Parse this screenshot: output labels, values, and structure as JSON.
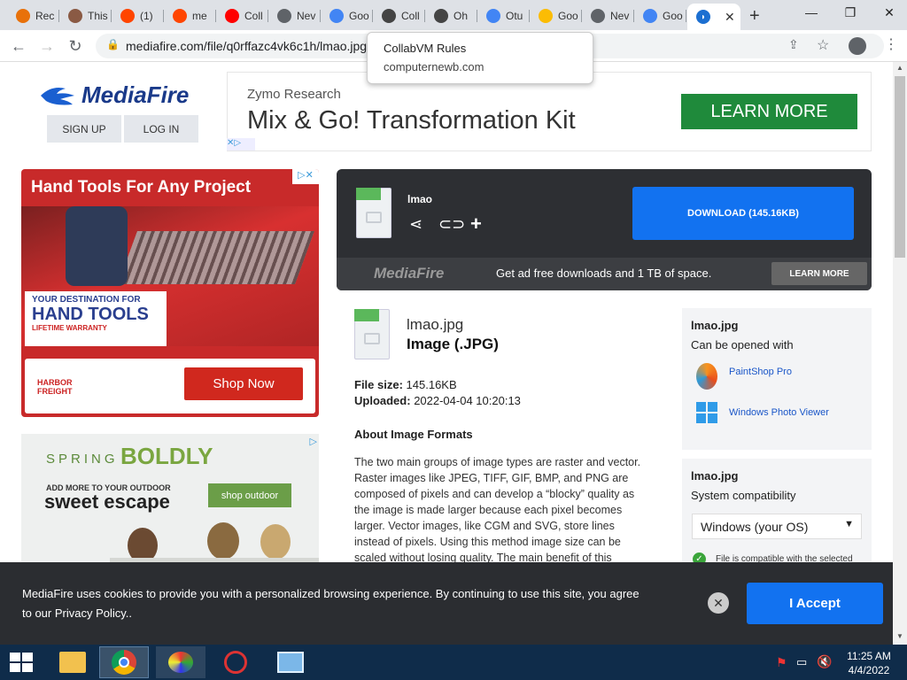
{
  "tabs": [
    {
      "title": "Rec",
      "icon": "pinwheel-icon",
      "color": "#e8710a"
    },
    {
      "title": "This",
      "icon": "avatar-icon",
      "color": "#8a5a44"
    },
    {
      "title": "(1) ",
      "icon": "reddit-icon",
      "color": "#ff4500"
    },
    {
      "title": "me",
      "icon": "reddit-icon",
      "color": "#ff4500"
    },
    {
      "title": "Coll",
      "icon": "youtube-icon",
      "color": "#ff0000"
    },
    {
      "title": "Nev",
      "icon": "chrome-page-icon",
      "color": "#5f6368"
    },
    {
      "title": "Goo",
      "icon": "google-icon",
      "color": "#4285f4"
    },
    {
      "title": "Coll",
      "icon": "collabvm-icon",
      "color": "#444444"
    },
    {
      "title": "Oh",
      "icon": "collabvm-icon",
      "color": "#444444"
    },
    {
      "title": "Otu",
      "icon": "google-icon",
      "color": "#4285f4"
    },
    {
      "title": "Goo",
      "icon": "google-photos-icon",
      "color": "#fbbc04"
    },
    {
      "title": "Nev",
      "icon": "chrome-page-icon",
      "color": "#5f6368"
    },
    {
      "title": "Goo",
      "icon": "google-icon",
      "color": "#4285f4"
    }
  ],
  "active_tab": {
    "icon": "mediafire-icon",
    "color": "#1c6fd1"
  },
  "address": {
    "url": "mediafire.com/file/q0rffazc4vk6c1h/lmao.jpg"
  },
  "tooltip": {
    "title": "CollabVM Rules",
    "subtitle": "computernewb.com"
  },
  "header": {
    "logo_text": "MediaFire",
    "sign_up": "SIGN UP",
    "log_in": "LOG IN"
  },
  "top_ad": {
    "brand": "Zymo Research",
    "headline": "Mix & Go! Transformation Kit",
    "cta": "LEARN MORE",
    "cta_color": "#1f8a3b"
  },
  "side_ad1": {
    "headline": "Hand Tools For Any Project",
    "line1": "YOUR DESTINATION FOR",
    "line2": "HAND TOOLS",
    "line3": "LIFETIME WARRANTY",
    "brand1": "HARBOR",
    "brand2": "FREIGHT",
    "cta": "Shop Now"
  },
  "side_ad2": {
    "word1": "SPRING",
    "word2": "BOLDLY",
    "line1": "ADD MORE TO YOUR OUTDOOR",
    "line2": "sweet escape",
    "cta": "shop outdoor"
  },
  "download": {
    "filename": "lmao",
    "button": "DOWNLOAD (145.16KB)",
    "strip_logo": "MediaFire",
    "promo": "Get ad free downloads and 1 TB of space.",
    "learn_more": "LEARN MORE"
  },
  "file": {
    "name": "lmao.jpg",
    "type": "Image (.JPG)",
    "size_label": "File size:",
    "size": "145.16KB",
    "uploaded_label": "Uploaded:",
    "uploaded": "2022-04-04 10:20:13",
    "about_title": "About Image Formats",
    "about_text": "The two main groups of image types are raster and vector. Raster images like JPEG, TIFF, GIF, BMP, and PNG are composed of pixels and can develop a “blocky” quality as the image is made larger because each pixel becomes larger. Vector images, like CGM and SVG, store lines instead of pixels. Using this method image size can be scaled without losing quality. The main benefit of this method is that vector"
  },
  "open_with": {
    "title": "lmao.jpg",
    "subtitle": "Can be opened with",
    "apps": [
      "PaintShop Pro",
      "Windows Photo Viewer"
    ]
  },
  "compat": {
    "title": "lmao.jpg",
    "subtitle": "System compatibility",
    "os": "Windows (your OS)",
    "status": "File is compatible with the selected operating system."
  },
  "cookie": {
    "text": "MediaFire uses cookies to provide you with a personalized browsing experience. By continuing to use this site, you agree to our Privacy Policy..",
    "accept": "I Accept"
  },
  "taskbar": {
    "time": "11:25 AM",
    "date": "4/4/2022"
  }
}
